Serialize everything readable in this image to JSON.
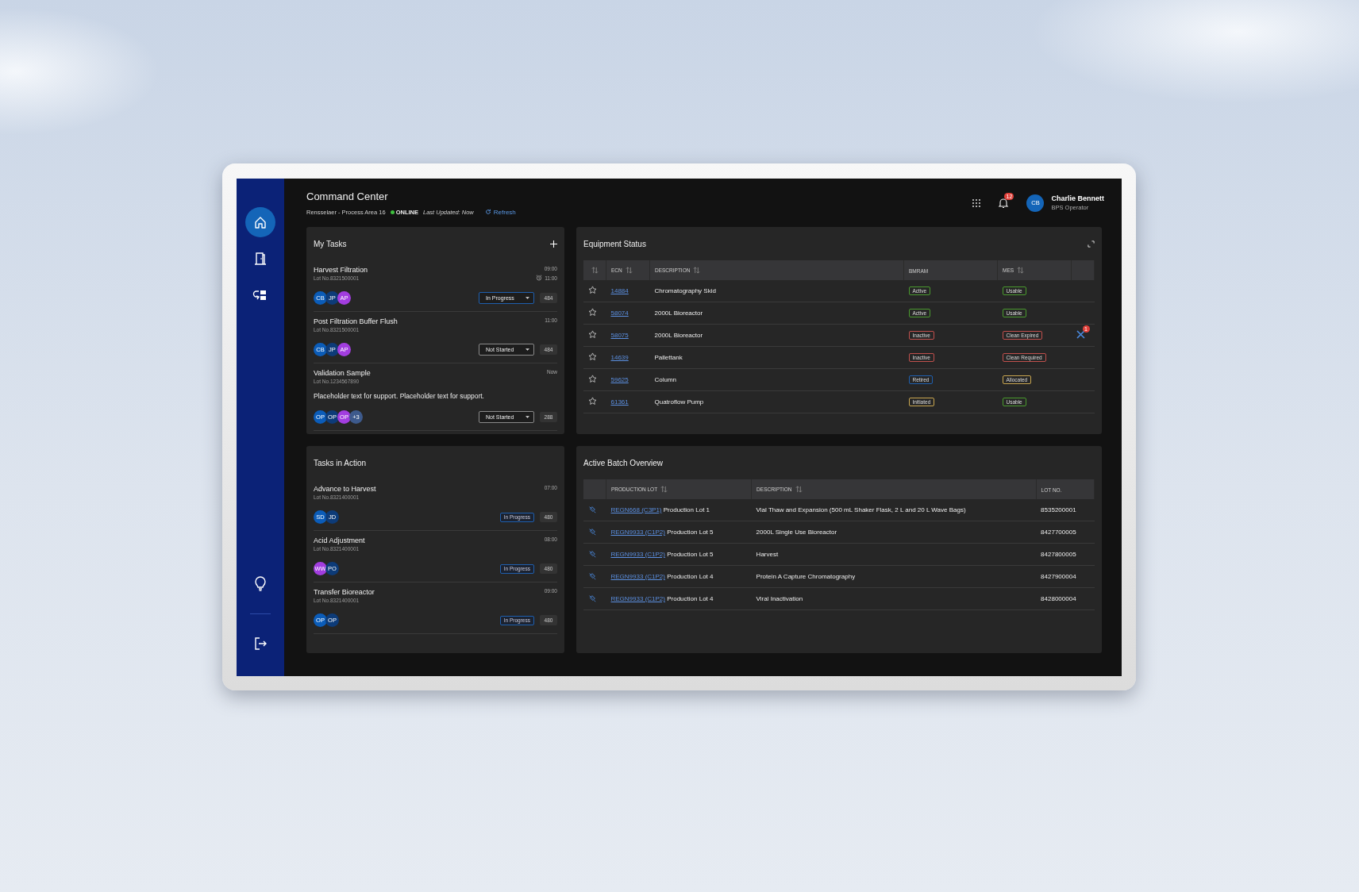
{
  "sidebar": {
    "items": [
      {
        "kind": "home",
        "selected": true
      },
      {
        "kind": "door",
        "selected": false
      },
      {
        "kind": "routing",
        "selected": false
      }
    ],
    "bottom_items": [
      {
        "kind": "bulb"
      },
      {
        "kind": "logout"
      }
    ]
  },
  "header": {
    "title": "Command Center",
    "location": "Rensselaer - Process Area 16",
    "status": "ONLINE",
    "last_updated": "Last Updated: Now",
    "refresh": "Refresh",
    "notifications": "12",
    "user": {
      "initials": "CB",
      "name": "Charlie Bennett",
      "role": "BPS Operator"
    }
  },
  "my_tasks": {
    "title": "My Tasks",
    "tasks": [
      {
        "name": "Harvest Filtration",
        "lot": "Lot No.8321500001",
        "times": [
          {
            "text": "09:00",
            "alarm": false
          },
          {
            "text": "11:00",
            "alarm": true
          }
        ],
        "assignees": [
          {
            "initials": "CB",
            "color": "#0b5cb8"
          },
          {
            "initials": "JP",
            "color": "#0d3b78"
          },
          {
            "initials": "AP",
            "color": "#a23ddf"
          }
        ],
        "status": {
          "label": "In Progress",
          "color": "#1f5fae"
        },
        "count": "484"
      },
      {
        "name": "Post Filtration Buffer Flush",
        "lot": "Lot No.8321500001",
        "times": [
          {
            "text": "11:00",
            "alarm": false
          }
        ],
        "assignees": [
          {
            "initials": "CB",
            "color": "#0b5cb8"
          },
          {
            "initials": "JP",
            "color": "#0d3b78"
          },
          {
            "initials": "AP",
            "color": "#a23ddf"
          }
        ],
        "status": {
          "label": "Not Started",
          "color": "#8a8a8a"
        },
        "count": "484"
      },
      {
        "name": "Validation Sample",
        "lot": "Lot No.1234567890",
        "times": [
          {
            "text": "Now",
            "alarm": false
          }
        ],
        "note": "Placeholder text for support. Placeholder text for support.",
        "assignees": [
          {
            "initials": "OP",
            "color": "#0b5cb8"
          },
          {
            "initials": "OP",
            "color": "#0d3b78"
          },
          {
            "initials": "OP",
            "color": "#a23ddf"
          },
          {
            "initials": "+3",
            "color": "#3d5a8c"
          }
        ],
        "status": {
          "label": "Not Started",
          "color": "#8a8a8a"
        },
        "count": "288"
      }
    ]
  },
  "equipment": {
    "title": "Equipment Status",
    "columns": [
      {
        "sortable": true
      },
      {
        "label": "ECN",
        "sortable": true
      },
      {
        "label": "DESCRIPTION",
        "sortable": true
      },
      {
        "label": "BMRAM",
        "sortable": false
      },
      {
        "label": "MES",
        "sortable": true
      }
    ],
    "rows": [
      {
        "starred": false,
        "ecn": "14884",
        "description": "Chromatography Skid",
        "bmram": {
          "label": "Active",
          "color": "#4a9a2e"
        },
        "mes": {
          "label": "Usable",
          "color": "#4a9a2e"
        }
      },
      {
        "starred": false,
        "ecn": "58074",
        "description": "2000L Bioreactor",
        "bmram": {
          "label": "Active",
          "color": "#4a9a2e"
        },
        "mes": {
          "label": "Usable",
          "color": "#4a9a2e"
        }
      },
      {
        "starred": false,
        "ecn": "58075",
        "description": "2000L Bioreactor",
        "bmram": {
          "label": "Inactive",
          "color": "#c0504d"
        },
        "mes": {
          "label": "Clean Expired",
          "color": "#c0504d"
        },
        "alert": "1"
      },
      {
        "starred": false,
        "ecn": "14639",
        "description": "Pallettank",
        "bmram": {
          "label": "Inactive",
          "color": "#c0504d"
        },
        "mes": {
          "label": "Clean Required",
          "color": "#c0504d"
        }
      },
      {
        "starred": false,
        "ecn": "59625",
        "description": "Column",
        "bmram": {
          "label": "Retired",
          "color": "#1f5fae"
        },
        "mes": {
          "label": "Allocated",
          "color": "#c9a650"
        }
      },
      {
        "starred": false,
        "ecn": "61361",
        "description": "Quatroflow Pump",
        "bmram": {
          "label": "Initiated",
          "color": "#c9a650"
        },
        "mes": {
          "label": "Usable",
          "color": "#4a9a2e"
        }
      }
    ]
  },
  "tasks_in_action": {
    "title": "Tasks in Action",
    "tasks": [
      {
        "name": "Advance to Harvest",
        "lot": "Lot No.8321400001",
        "time": "07:00",
        "assignees": [
          {
            "initials": "SD",
            "color": "#0b5cb8"
          },
          {
            "initials": "JD",
            "color": "#0d3b78"
          }
        ],
        "status": "In Progress",
        "count": "480"
      },
      {
        "name": "Acid Adjustment",
        "lot": "Lot No.8321400001",
        "time": "08:00",
        "assignees": [
          {
            "initials": "WW",
            "color": "#a23ddf"
          },
          {
            "initials": "PO",
            "color": "#0d3b78"
          }
        ],
        "status": "In Progress",
        "count": "480"
      },
      {
        "name": "Transfer Bioreactor",
        "lot": "Lot No.8321400001",
        "time": "09:00",
        "assignees": [
          {
            "initials": "OP",
            "color": "#0b5cb8"
          },
          {
            "initials": "OP",
            "color": "#0d3b78"
          }
        ],
        "status": "In Progress",
        "count": "480"
      }
    ]
  },
  "batch": {
    "title": "Active Batch Overview",
    "columns": [
      {
        "label": "PRODUCTION LOT",
        "sortable": true
      },
      {
        "label": "DESCRIPTION",
        "sortable": true
      },
      {
        "label": "LOT NO.",
        "sortable": false
      }
    ],
    "rows": [
      {
        "lot_link": "REGN668 (C3P1)",
        "lot_text": "Production Lot 1",
        "description": "Vial Thaw and Expansion (500 mL Shaker Flask, 2 L and 20 L Wave Bags)",
        "lot_no": "8535200001"
      },
      {
        "lot_link": "REGN9933 (C1P2)",
        "lot_text": "Production Lot 5",
        "description": "2000L Single Use Bioreactor",
        "lot_no": "8427700005"
      },
      {
        "lot_link": "REGN9933 (C1P2)",
        "lot_text": "Production Lot 5",
        "description": "Harvest",
        "lot_no": "8427800005"
      },
      {
        "lot_link": "REGN9933 (C1P2)",
        "lot_text": "Production Lot 4",
        "description": "Protein A Capture Chromatography",
        "lot_no": "8427900004"
      },
      {
        "lot_link": "REGN9933 (C1P2)",
        "lot_text": "Production Lot 4",
        "description": "Viral Inactivation",
        "lot_no": "8428000004"
      }
    ]
  }
}
